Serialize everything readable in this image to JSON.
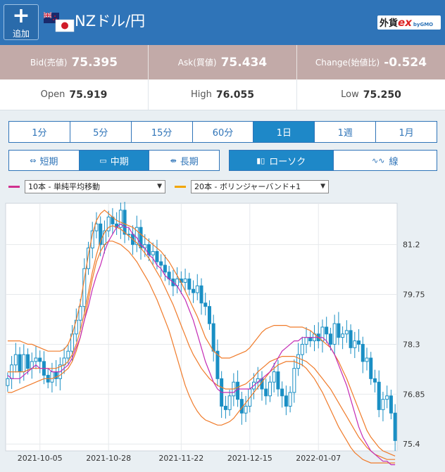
{
  "header": {
    "add_label": "追加",
    "pair_title": "NZドル/円",
    "logo_main": "外貨",
    "logo_ex": "ex",
    "logo_sub": "byGMO"
  },
  "quotes": {
    "bid_label": "Bid(売値)",
    "bid_value": "75.395",
    "ask_label": "Ask(買値)",
    "ask_value": "75.434",
    "change_label": "Change(始値比)",
    "change_value": "-0.524"
  },
  "ohl": {
    "open_label": "Open",
    "open_value": "75.919",
    "high_label": "High",
    "high_value": "76.055",
    "low_label": "Low",
    "low_value": "75.250"
  },
  "timeframes": [
    "1分",
    "5分",
    "15分",
    "60分",
    "1日",
    "1週",
    "1月"
  ],
  "active_timeframe": "1日",
  "terms": [
    "短期",
    "中期",
    "長期"
  ],
  "active_term": "中期",
  "chart_types": [
    "ローソク",
    "線"
  ],
  "active_chart_type": "ローソク",
  "indicators": {
    "ma_label": "10本 - 単純平均移動",
    "bb_label": "20本 - ボリンジャーバンド+1",
    "ma_color": "#d0308f",
    "bb_color": "#f2a600"
  },
  "colors": {
    "header_bg": "#2f74b8",
    "quote_bg": "#c2aaa8",
    "active_bg": "#1e88c8",
    "candle": "#1a8fc4",
    "band": "#f07b2a",
    "ma": "#c42bb5"
  },
  "chart_data": {
    "type": "candlestick",
    "title": "",
    "xlabel": "",
    "ylabel": "",
    "ylim": [
      75.2,
      82.4
    ],
    "y_ticks": [
      81.2,
      79.75,
      78.3,
      76.85,
      75.4
    ],
    "y_tick_labels": [
      "81.2",
      "79.75",
      "78.3",
      "76.85",
      "75.4"
    ],
    "x_tick_labels": [
      "2021-10-05",
      "2021-10-28",
      "2021-11-22",
      "2021-12-15",
      "2022-01-07"
    ],
    "x_tick_index": [
      8,
      25,
      43,
      60,
      77
    ],
    "grid": true,
    "close": [
      77.3,
      77.7,
      78.0,
      77.5,
      78.0,
      77.6,
      77.8,
      77.9,
      77.8,
      77.4,
      77.2,
      77.5,
      77.3,
      77.7,
      77.9,
      78.1,
      78.6,
      79.0,
      79.4,
      80.5,
      81.1,
      81.6,
      81.8,
      81.2,
      81.6,
      82.0,
      81.8,
      81.7,
      82.2,
      81.5,
      81.5,
      81.2,
      81.7,
      81.1,
      81.2,
      80.9,
      81.0,
      80.7,
      80.6,
      80.4,
      80.2,
      80.0,
      80.2,
      80.1,
      80.2,
      79.9,
      79.8,
      80.0,
      79.5,
      79.4,
      78.9,
      78.1,
      77.3,
      76.5,
      76.4,
      76.8,
      77.2,
      76.7,
      76.3,
      76.5,
      77.0,
      77.2,
      77.3,
      77.0,
      76.8,
      77.2,
      77.5,
      77.0,
      76.8,
      76.5,
      76.9,
      77.6,
      78.0,
      78.3,
      78.5,
      78.4,
      78.6,
      78.4,
      78.8,
      78.6,
      78.3,
      78.9,
      78.5,
      78.6,
      78.7,
      78.2,
      78.4,
      78.3,
      77.8,
      77.9,
      77.3,
      77.2,
      76.4,
      76.7,
      76.8,
      76.3,
      75.5
    ],
    "ma10": [
      77.4,
      77.3,
      77.3,
      77.3,
      77.4,
      77.5,
      77.6,
      77.7,
      77.6,
      77.6,
      77.6,
      77.5,
      77.5,
      77.5,
      77.6,
      77.7,
      77.9,
      78.2,
      78.5,
      79.0,
      79.4,
      79.9,
      80.3,
      80.6,
      81.0,
      81.3,
      81.5,
      81.7,
      81.8,
      81.7,
      81.7,
      81.5,
      81.4,
      81.2,
      81.1,
      80.9,
      80.8,
      80.6,
      80.5,
      80.3,
      80.2,
      80.1,
      80.0,
      79.8,
      79.6,
      79.3,
      79.0,
      78.6,
      78.2,
      77.8,
      77.5,
      77.2,
      77.0,
      76.9,
      76.9,
      76.9,
      76.9,
      77.0,
      77.0,
      77.0,
      77.0,
      77.1,
      77.2,
      77.3,
      77.4,
      77.5,
      77.7,
      77.9,
      78.1,
      78.2,
      78.3,
      78.4,
      78.4,
      78.5,
      78.5,
      78.5,
      78.5,
      78.5,
      78.5,
      78.4,
      78.2,
      78.0,
      77.7,
      77.4,
      77.1,
      76.7,
      76.3,
      75.9,
      75.6,
      75.4,
      75.2,
      75.1,
      75.0,
      74.9,
      74.9,
      74.8,
      74.8
    ],
    "bb_upper": [
      78.4,
      78.4,
      78.4,
      78.4,
      78.35,
      78.3,
      78.3,
      78.25,
      78.2,
      78.15,
      78.1,
      78.1,
      78.1,
      78.1,
      78.15,
      78.3,
      78.6,
      79.0,
      79.5,
      80.2,
      80.9,
      81.5,
      81.9,
      82.1,
      82.2,
      82.1,
      82.0,
      81.9,
      81.85,
      81.8,
      81.75,
      81.7,
      81.6,
      81.5,
      81.4,
      81.3,
      81.2,
      81.1,
      81.0,
      80.85,
      80.7,
      80.5,
      80.3,
      80.1,
      79.85,
      79.6,
      79.35,
      79.1,
      78.8,
      78.5,
      78.3,
      78.1,
      78.0,
      77.9,
      77.9,
      77.9,
      77.95,
      78.0,
      78.05,
      78.1,
      78.2,
      78.35,
      78.5,
      78.65,
      78.75,
      78.8,
      78.85,
      78.85,
      78.85,
      78.85,
      78.8,
      78.8,
      78.8,
      78.8,
      78.75,
      78.7,
      78.6,
      78.5,
      78.4,
      78.3,
      78.2,
      78.0,
      77.8,
      77.55,
      77.3,
      77.0,
      76.7,
      76.4,
      76.1,
      75.8,
      75.6,
      75.45,
      75.3,
      75.2,
      75.15,
      75.1,
      75.05
    ],
    "bb_lower": [
      76.9,
      76.9,
      76.95,
      77.0,
      77.05,
      77.1,
      77.15,
      77.2,
      77.25,
      77.3,
      77.3,
      77.3,
      77.35,
      77.4,
      77.5,
      77.6,
      77.8,
      78.1,
      78.5,
      79.0,
      79.6,
      80.2,
      80.7,
      81.0,
      81.2,
      81.3,
      81.3,
      81.25,
      81.2,
      81.1,
      81.0,
      80.85,
      80.7,
      80.5,
      80.3,
      80.1,
      79.85,
      79.6,
      79.3,
      79.0,
      78.7,
      78.3,
      77.9,
      77.5,
      77.1,
      76.8,
      76.55,
      76.35,
      76.2,
      76.1,
      76.05,
      76.0,
      75.95,
      75.95,
      76.0,
      76.05,
      76.15,
      76.3,
      76.45,
      76.6,
      76.75,
      76.9,
      77.05,
      77.2,
      77.35,
      77.5,
      77.6,
      77.7,
      77.75,
      77.8,
      77.8,
      77.8,
      77.75,
      77.7,
      77.6,
      77.45,
      77.3,
      77.1,
      76.9,
      76.65,
      76.4,
      76.15,
      75.9,
      75.7,
      75.5,
      75.3,
      75.15,
      75.05,
      74.95,
      74.9,
      74.85,
      74.85,
      74.85,
      74.85,
      74.85,
      74.85,
      74.85
    ],
    "bb_mid": [
      77.5,
      77.5,
      77.5,
      77.5,
      77.5,
      77.55,
      77.6,
      77.6,
      77.6,
      77.6,
      77.6,
      77.6,
      77.6,
      77.65,
      77.7,
      77.8,
      78.0,
      78.3,
      78.7,
      79.2,
      79.8,
      80.4,
      80.9,
      81.3,
      81.55,
      81.7,
      81.75,
      81.7,
      81.65,
      81.55,
      81.45,
      81.35,
      81.25,
      81.1,
      80.95,
      80.8,
      80.6,
      80.4,
      80.2,
      79.95,
      79.7,
      79.45,
      79.15,
      78.85,
      78.55,
      78.25,
      78.0,
      77.8,
      77.6,
      77.45,
      77.3,
      77.2,
      77.1,
      77.05,
      77.0,
      77.0,
      77.0,
      77.05,
      77.1,
      77.15,
      77.25,
      77.35,
      77.5,
      77.6,
      77.7,
      77.8,
      77.85,
      77.9,
      77.95,
      77.95,
      77.95,
      77.95,
      77.9,
      77.85,
      77.8,
      77.7,
      77.6,
      77.45,
      77.3,
      77.15,
      77.0,
      76.8,
      76.6,
      76.4,
      76.2,
      76.0,
      75.8,
      75.6,
      75.45,
      75.3,
      75.2,
      75.1,
      75.05,
      75.0,
      74.95,
      74.95,
      74.95
    ]
  }
}
